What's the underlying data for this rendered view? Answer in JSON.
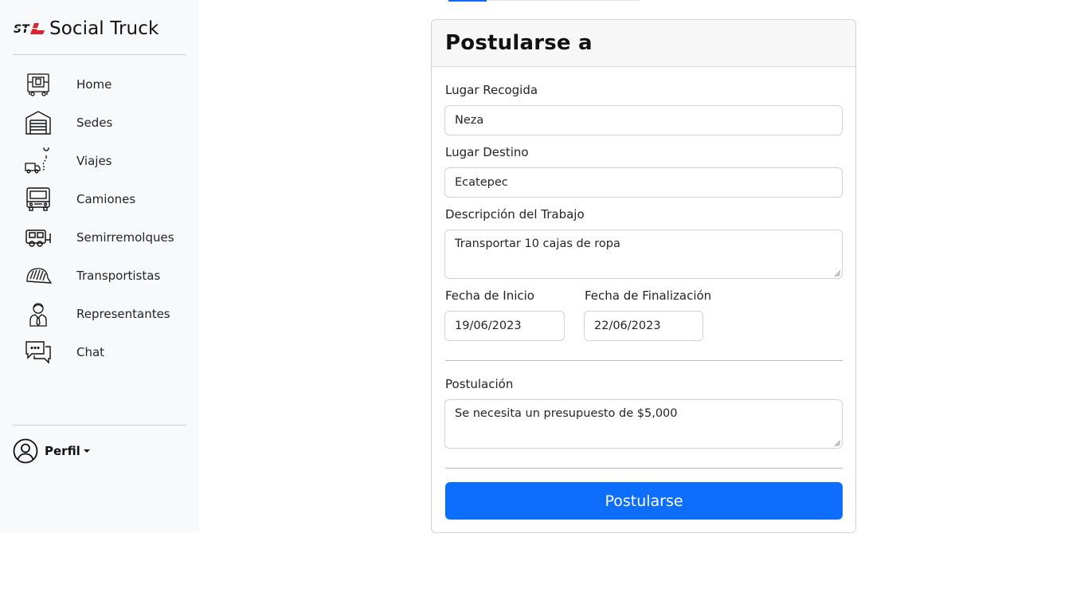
{
  "app": {
    "brand_name": "Social Truck",
    "brand_logo_text": "STL"
  },
  "sidebar": {
    "items": [
      {
        "label": "Home",
        "icon": "home-truck-icon"
      },
      {
        "label": "Sedes",
        "icon": "warehouse-icon"
      },
      {
        "label": "Viajes",
        "icon": "delivery-route-icon"
      },
      {
        "label": "Camiones",
        "icon": "truck-front-icon"
      },
      {
        "label": "Semirremolques",
        "icon": "trailer-icon"
      },
      {
        "label": "Transportistas",
        "icon": "driver-cap-icon"
      },
      {
        "label": "Representantes",
        "icon": "representative-icon"
      },
      {
        "label": "Chat",
        "icon": "chat-icon"
      }
    ],
    "profile": {
      "label": "Perfil",
      "icon": "user-circle-icon"
    }
  },
  "form": {
    "title": "Postularse a",
    "pickup": {
      "label": "Lugar Recogida",
      "value": "Neza"
    },
    "destination": {
      "label": "Lugar Destino",
      "value": "Ecatepec"
    },
    "description": {
      "label": "Descripción del Trabajo",
      "value": "Transportar 10 cajas de ropa"
    },
    "start_date": {
      "label": "Fecha de Inicio",
      "value": "19/06/2023"
    },
    "end_date": {
      "label": "Fecha de Finalización",
      "value": "22/06/2023"
    },
    "application": {
      "label": "Postulación",
      "value": "Se necesita un presupuesto de $5,000"
    },
    "submit_label": "Postularse"
  },
  "colors": {
    "primary": "#0d6efd",
    "sidebar_bg": "#f8f9fa",
    "header_bg": "#f7f7f7",
    "brand_red": "#e0202a"
  }
}
